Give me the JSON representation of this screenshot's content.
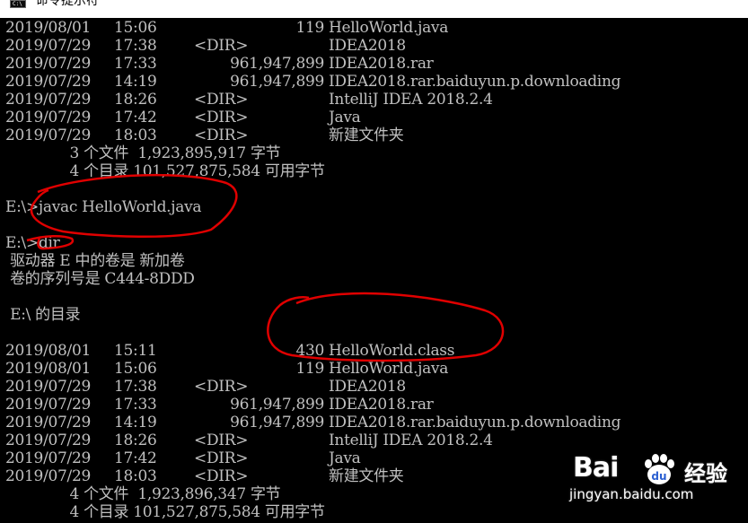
{
  "window": {
    "title": "命令提示符",
    "icon": "console-icon"
  },
  "console": {
    "lines": [
      {
        "date": "2019/08/01",
        "time": "15:06",
        "dir": "",
        "size": "119",
        "name": "HelloWorld.java"
      },
      {
        "date": "2019/07/29",
        "time": "17:38",
        "dir": "<DIR>",
        "size": "",
        "name": "IDEA2018"
      },
      {
        "date": "2019/07/29",
        "time": "17:33",
        "dir": "",
        "size": "961,947,899",
        "name": "IDEA2018.rar"
      },
      {
        "date": "2019/07/29",
        "time": "14:19",
        "dir": "",
        "size": "961,947,899",
        "name": "IDEA2018.rar.baiduyun.p.downloading"
      },
      {
        "date": "2019/07/29",
        "time": "18:26",
        "dir": "<DIR>",
        "size": "",
        "name": "IntelliJ IDEA 2018.2.4"
      },
      {
        "date": "2019/07/29",
        "time": "17:42",
        "dir": "<DIR>",
        "size": "",
        "name": "Java"
      },
      {
        "date": "2019/07/29",
        "time": "18:03",
        "dir": "<DIR>",
        "size": "",
        "name": "新建文件夹"
      },
      {
        "text": "              3 个文件  1,923,895,917 字节"
      },
      {
        "text": "              4 个目录 101,527,875,584 可用字节"
      },
      {
        "text": ""
      },
      {
        "text": "E:\\>javac HelloWorld.java"
      },
      {
        "text": ""
      },
      {
        "text": "E:\\>dir"
      },
      {
        "text": " 驱动器 E 中的卷是 新加卷"
      },
      {
        "text": " 卷的序列号是 C444-8DDD"
      },
      {
        "text": ""
      },
      {
        "text": " E:\\ 的目录"
      },
      {
        "text": ""
      },
      {
        "date": "2019/08/01",
        "time": "15:11",
        "dir": "",
        "size": "430",
        "name": "HelloWorld.class"
      },
      {
        "date": "2019/08/01",
        "time": "15:06",
        "dir": "",
        "size": "119",
        "name": "HelloWorld.java"
      },
      {
        "date": "2019/07/29",
        "time": "17:38",
        "dir": "<DIR>",
        "size": "",
        "name": "IDEA2018"
      },
      {
        "date": "2019/07/29",
        "time": "17:33",
        "dir": "",
        "size": "961,947,899",
        "name": "IDEA2018.rar"
      },
      {
        "date": "2019/07/29",
        "time": "14:19",
        "dir": "",
        "size": "961,947,899",
        "name": "IDEA2018.rar.baiduyun.p.downloading"
      },
      {
        "date": "2019/07/29",
        "time": "18:26",
        "dir": "<DIR>",
        "size": "",
        "name": "IntelliJ IDEA 2018.2.4"
      },
      {
        "date": "2019/07/29",
        "time": "17:42",
        "dir": "<DIR>",
        "size": "",
        "name": "Java"
      },
      {
        "date": "2019/07/29",
        "time": "18:03",
        "dir": "<DIR>",
        "size": "",
        "name": "新建文件夹"
      },
      {
        "text": "              4 个文件  1,923,896,347 字节"
      },
      {
        "text": "              4 个目录 101,527,875,584 可用字节"
      }
    ]
  },
  "annotation": {
    "color": "#e00000"
  },
  "watermark": {
    "brand_left": "Bai",
    "brand_right": "经验",
    "paw_text": "du",
    "url": "jingyan.baidu.com"
  },
  "colors": {
    "background": "#000000",
    "text": "#c0c0c0",
    "titlebar": "#ffffff"
  }
}
